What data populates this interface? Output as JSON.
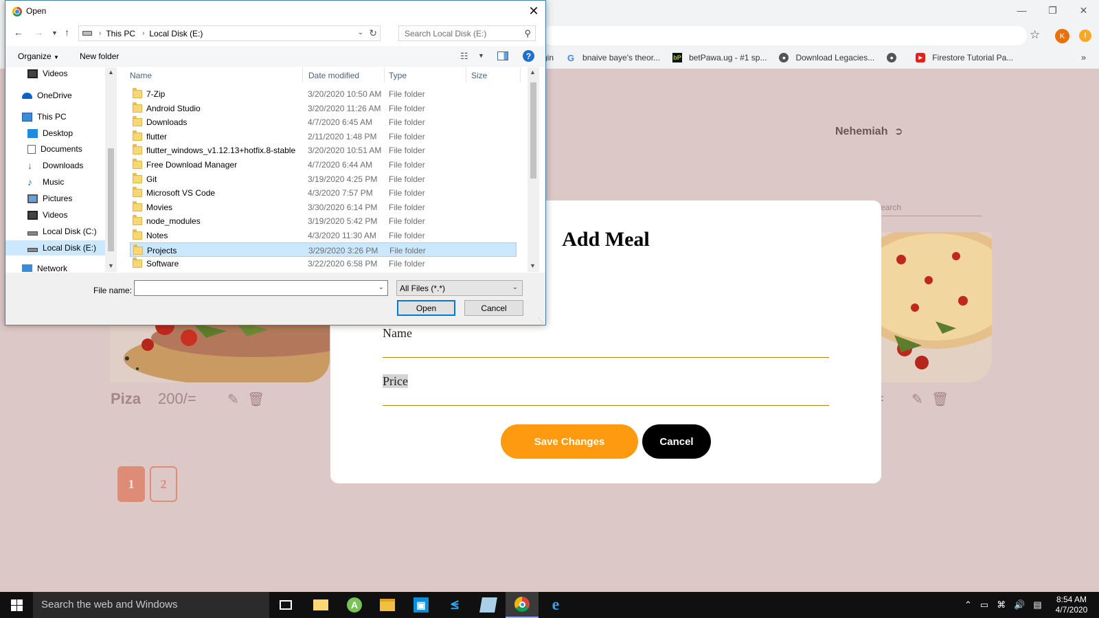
{
  "bookmarks": [
    {
      "label": "gin",
      "icon": "none"
    },
    {
      "label": "bnaive baye's theor...",
      "icon": "google-icon"
    },
    {
      "label": "betPawa.ug - #1 sp...",
      "icon": "betpawa-icon"
    },
    {
      "label": "Download Legacies...",
      "icon": "globe-icon"
    },
    {
      "label": "",
      "icon": "globe-icon"
    },
    {
      "label": "Firestore Tutorial Pa...",
      "icon": "youtube-icon"
    }
  ],
  "profile_initial": "K",
  "page": {
    "user": "Nehemiah",
    "search_placeholder": "Search",
    "card1": {
      "name": "Piza",
      "price": "200/="
    },
    "card2": {
      "price_fragment": "="
    },
    "pagination": [
      "1",
      "2"
    ]
  },
  "modal": {
    "title": "Add Meal",
    "name_label": "Name",
    "price_label": "Price",
    "save_label": "Save Changes",
    "cancel_label": "Cancel"
  },
  "dialog": {
    "title": "Open",
    "breadcrumb": [
      "This PC",
      "Local Disk (E:)"
    ],
    "search_placeholder": "Search Local Disk (E:)",
    "organize_label": "Organize",
    "new_folder_label": "New folder",
    "nav_items": [
      {
        "label": "Videos",
        "icon": "videos-icon"
      },
      {
        "label": "OneDrive",
        "icon": "onedrive-icon"
      },
      {
        "label": "This PC",
        "icon": "this-pc-icon"
      },
      {
        "label": "Desktop",
        "icon": "desktop-icon"
      },
      {
        "label": "Documents",
        "icon": "documents-icon"
      },
      {
        "label": "Downloads",
        "icon": "downloads-icon"
      },
      {
        "label": "Music",
        "icon": "music-icon"
      },
      {
        "label": "Pictures",
        "icon": "pictures-icon"
      },
      {
        "label": "Videos",
        "icon": "videos-icon"
      },
      {
        "label": "Local Disk (C:)",
        "icon": "drive-icon"
      },
      {
        "label": "Local Disk (E:)",
        "icon": "drive-icon"
      },
      {
        "label": "Network",
        "icon": "network-icon"
      }
    ],
    "columns": [
      "Name",
      "Date modified",
      "Type",
      "Size"
    ],
    "files": [
      {
        "name": "7-Zip",
        "date": "3/20/2020 10:50 AM",
        "type": "File folder"
      },
      {
        "name": "Android Studio",
        "date": "3/20/2020 11:26 AM",
        "type": "File folder"
      },
      {
        "name": "Downloads",
        "date": "4/7/2020 6:45 AM",
        "type": "File folder"
      },
      {
        "name": "flutter",
        "date": "2/11/2020 1:48 PM",
        "type": "File folder"
      },
      {
        "name": "flutter_windows_v1.12.13+hotfix.8-stable",
        "date": "3/20/2020 10:51 AM",
        "type": "File folder"
      },
      {
        "name": "Free Download Manager",
        "date": "4/7/2020 6:44 AM",
        "type": "File folder"
      },
      {
        "name": "Git",
        "date": "3/19/2020 4:25 PM",
        "type": "File folder"
      },
      {
        "name": "Microsoft VS Code",
        "date": "4/3/2020 7:57 PM",
        "type": "File folder"
      },
      {
        "name": "Movies",
        "date": "3/30/2020 6:14 PM",
        "type": "File folder"
      },
      {
        "name": "node_modules",
        "date": "3/19/2020 5:42 PM",
        "type": "File folder"
      },
      {
        "name": "Notes",
        "date": "4/3/2020 11:30 AM",
        "type": "File folder"
      },
      {
        "name": "Projects",
        "date": "3/29/2020 3:26 PM",
        "type": "File folder",
        "selected": true
      },
      {
        "name": "Software",
        "date": "3/22/2020 6:58 PM",
        "type": "File folder"
      }
    ],
    "filename_label": "File name:",
    "filename_value": "",
    "filter_value": "All Files (*.*)",
    "open_label": "Open",
    "cancel_label": "Cancel"
  },
  "taskbar": {
    "search_placeholder": "Search the web and Windows",
    "apps": [
      "task-view-icon",
      "folder-app-icon",
      "android-studio-icon",
      "file-explorer-icon",
      "store-icon",
      "vscode-icon",
      "notepad-icon",
      "chrome-icon",
      "edge-icon"
    ],
    "time": "8:54 AM",
    "date": "4/7/2020"
  }
}
